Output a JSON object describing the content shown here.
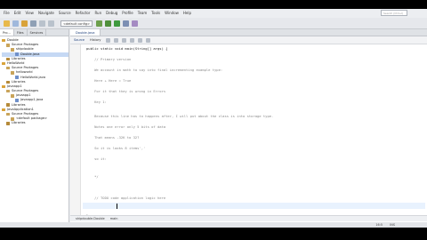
{
  "menu": [
    "File",
    "Edit",
    "View",
    "Navigate",
    "Source",
    "Refactor",
    "Run",
    "Debug",
    "Profile",
    "Team",
    "Tools",
    "Window",
    "Help"
  ],
  "search_placeholder": "Search (Ctrl+I)",
  "toolbar": {
    "config_value": "<default config>"
  },
  "left_panel": {
    "tabs": [
      "Pro...",
      "Files",
      "Services"
    ],
    "tree": [
      {
        "label": "Double",
        "indent": 0,
        "color": "#d9a33a"
      },
      {
        "label": "Source Packages",
        "indent": 1,
        "color": "#c9a45a"
      },
      {
        "label": "shipdouble",
        "indent": 2,
        "color": "#c9a45a"
      },
      {
        "label": "Double.java",
        "indent": 3,
        "color": "#6e8fc9",
        "selected": true
      },
      {
        "label": "Libraries",
        "indent": 1,
        "color": "#b58a3a"
      },
      {
        "label": "HelloWorld",
        "indent": 0,
        "color": "#d9a33a"
      },
      {
        "label": "Source Packages",
        "indent": 1,
        "color": "#c9a45a"
      },
      {
        "label": "helloworld",
        "indent": 2,
        "color": "#c9a45a"
      },
      {
        "label": "HelloWorld.java",
        "indent": 3,
        "color": "#6e8fc9"
      },
      {
        "label": "Libraries",
        "indent": 1,
        "color": "#b58a3a"
      },
      {
        "label": "Javaapp1",
        "indent": 0,
        "color": "#d9a33a"
      },
      {
        "label": "Source Packages",
        "indent": 1,
        "color": "#c9a45a"
      },
      {
        "label": "javaapp1",
        "indent": 2,
        "color": "#c9a45a"
      },
      {
        "label": "Javaapp1.java",
        "indent": 3,
        "color": "#6e8fc9"
      },
      {
        "label": "Libraries",
        "indent": 1,
        "color": "#b58a3a"
      },
      {
        "label": "JavaApplication1",
        "indent": 0,
        "color": "#d9a33a"
      },
      {
        "label": "Source Packages",
        "indent": 1,
        "color": "#c9a45a"
      },
      {
        "label": "<default package>",
        "indent": 2,
        "color": "#c9a45a"
      },
      {
        "label": "Libraries",
        "indent": 1,
        "color": "#b58a3a"
      }
    ]
  },
  "editor": {
    "tabs": [
      "Source",
      "History"
    ],
    "file_tab": "Double.java",
    "lines": [
      {
        "text": "public static void main(String[] args) {",
        "comment": false
      },
      {
        "text": "    // Primary version",
        "comment": true
      },
      {
        "text": "    We account in math to say into final incrementing example type:",
        "comment": true
      },
      {
        "text": "    Here + Here = True",
        "comment": true
      },
      {
        "text": "    For it that they is wrong in Errors",
        "comment": true
      },
      {
        "text": "    Key 1:",
        "comment": true
      },
      {
        "text": "    Because this line has to happens after, I will put about the class is into storage type.",
        "comment": true
      },
      {
        "text": "    Notes one error only 5 bits of data",
        "comment": true
      },
      {
        "text": "    That means -32K to 32?",
        "comment": true
      },
      {
        "text": "    So it is looks 8 items','",
        "comment": true
      },
      {
        "text": "    so it:",
        "comment": true
      },
      {
        "text": "    */",
        "comment": true
      },
      {
        "text": "",
        "comment": false
      },
      {
        "text": "    // TODO code application logic here",
        "comment": true
      },
      {
        "text": "}",
        "comment": false
      }
    ]
  },
  "breadcrumbs": [
    "shipdouble.Double",
    "main"
  ],
  "status": {
    "position": "16:5",
    "mode": "INS"
  }
}
